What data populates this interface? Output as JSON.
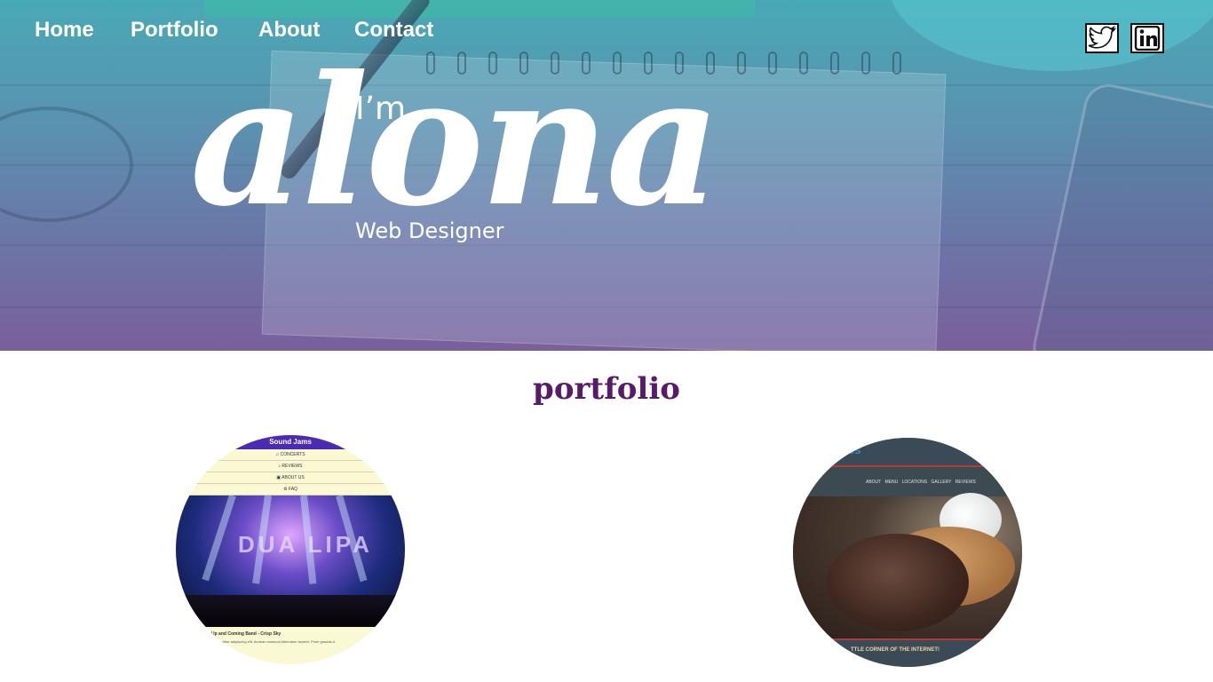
{
  "nav": {
    "items": [
      {
        "label": "Home"
      },
      {
        "label": "Portfolio"
      },
      {
        "label": "About"
      },
      {
        "label": "Contact"
      }
    ]
  },
  "social": {
    "twitter_icon": "twitter-icon",
    "linkedin_icon": "linkedin-icon"
  },
  "hero": {
    "intro": "I’m",
    "name": "alona",
    "role": "Web Designer"
  },
  "portfolio": {
    "title": "portfolio",
    "projects": [
      {
        "site_title": "Sound Jams",
        "menu": [
          "♫ CONCERTS",
          "♪ REVIEWS",
          "▣ ABOUT US",
          "⚙ FAQ"
        ],
        "image_text": "DUA LIPA",
        "caption": "Up and Coming Band - Crisp Sky",
        "caption_sub": "consectetur adipiscing elit. Aenean euismod bibendum laoreet. Proin gravida d"
      },
      {
        "site_title": "es",
        "menu": "ABOUT MENU LOCATIONS GALLERY REVIEWS",
        "tagline": "TTLE CORNER OF THE INTERNET!"
      }
    ]
  },
  "colors": {
    "hero_top": "#49a9b6",
    "hero_bottom": "#7a5f9c",
    "title": "#5a1a6a",
    "sound_jams_header": "#4b2bb1",
    "cookie_logo": "#3a89d6"
  }
}
